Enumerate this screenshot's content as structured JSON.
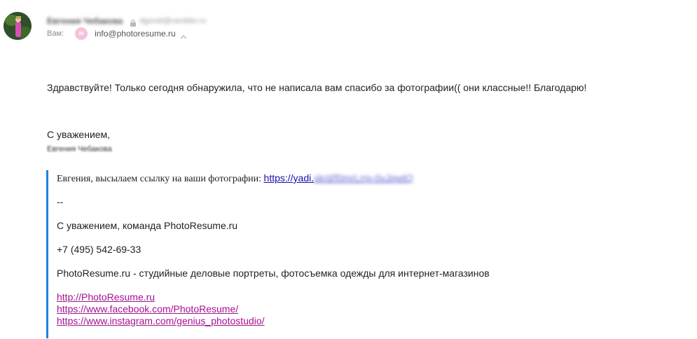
{
  "header": {
    "sender_name": "Евгения Чебакова",
    "sender_email": "dgora9@rambler.ru",
    "to_label": "Вам:",
    "to_badge": "IN",
    "to_email": "info@photoresume.ru"
  },
  "body": {
    "greeting": "Здравствуйте! Только сегодня обнаружила, что не написала вам спасибо за фотографии(( они классные!! Благодарю!",
    "signature_line1": "С уважением,",
    "signature_line2": "Евгения Чебакова"
  },
  "quote": {
    "intro": "Евгения, высылаем ссылку на ваши фотографии: ",
    "link_visible": "https://yadi.",
    "link_blurred": "sk/d/f0mrLrrp-0vJqwtQ",
    "dash": "--",
    "regards": "С уважением, команда PhotoResume.ru",
    "phone": "+7 (495) 542-69-33",
    "description": "PhotoResume.ru - студийные деловые портреты, фотосъемка одежды для интернет-магазинов",
    "links": [
      "http://PhotoResume.ru",
      "https://www.facebook.com/PhotoResume/",
      "https://www.instagram.com/genius_photostudio/"
    ]
  },
  "colors": {
    "quote_border": "#1a82e2",
    "link_visited": "#a4128f",
    "link": "#1a0dab",
    "badge": "#f7c0dd"
  }
}
